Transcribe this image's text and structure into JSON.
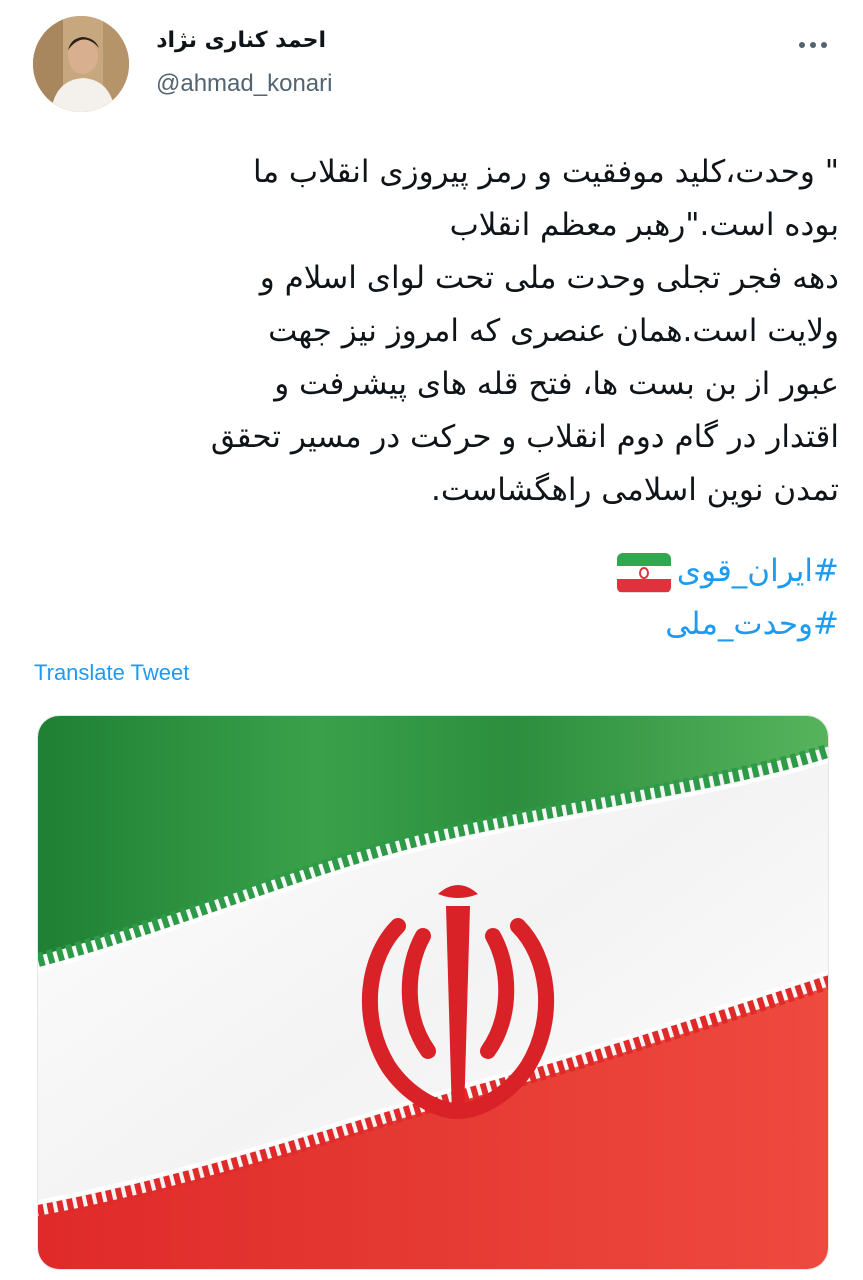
{
  "author": {
    "display_name": "احمد کناری نژاد",
    "handle": "@ahmad_konari"
  },
  "tweet": {
    "lines": [
      "\" وحدت،کلید موفقیت و رمز پیروزی انقلاب ما",
      "بوده است.\"رهبر معظم انقلاب",
      "دهه فجر تجلی وحدت ملی تحت لوای اسلام و",
      "ولایت است.همان عنصری که امروز نیز جهت",
      "عبور از بن بست ها، فتح قله های پیشرفت و",
      "اقتدار در گام دوم انقلاب و حرکت در مسیر تحقق",
      "تمدن نوین اسلامی راهگشاست."
    ],
    "hashtags": [
      "#ایران_قوی",
      "#وحدت_ملی"
    ],
    "translate_label": "Translate Tweet"
  },
  "icons": {
    "more": "more-horizontal-icon",
    "flag": "iran-flag-emoji-icon"
  },
  "colors": {
    "link": "#1d9bf0",
    "text": "#0f1419",
    "secondary": "#536471",
    "flag_green": "#239f40",
    "flag_red": "#da0000"
  }
}
